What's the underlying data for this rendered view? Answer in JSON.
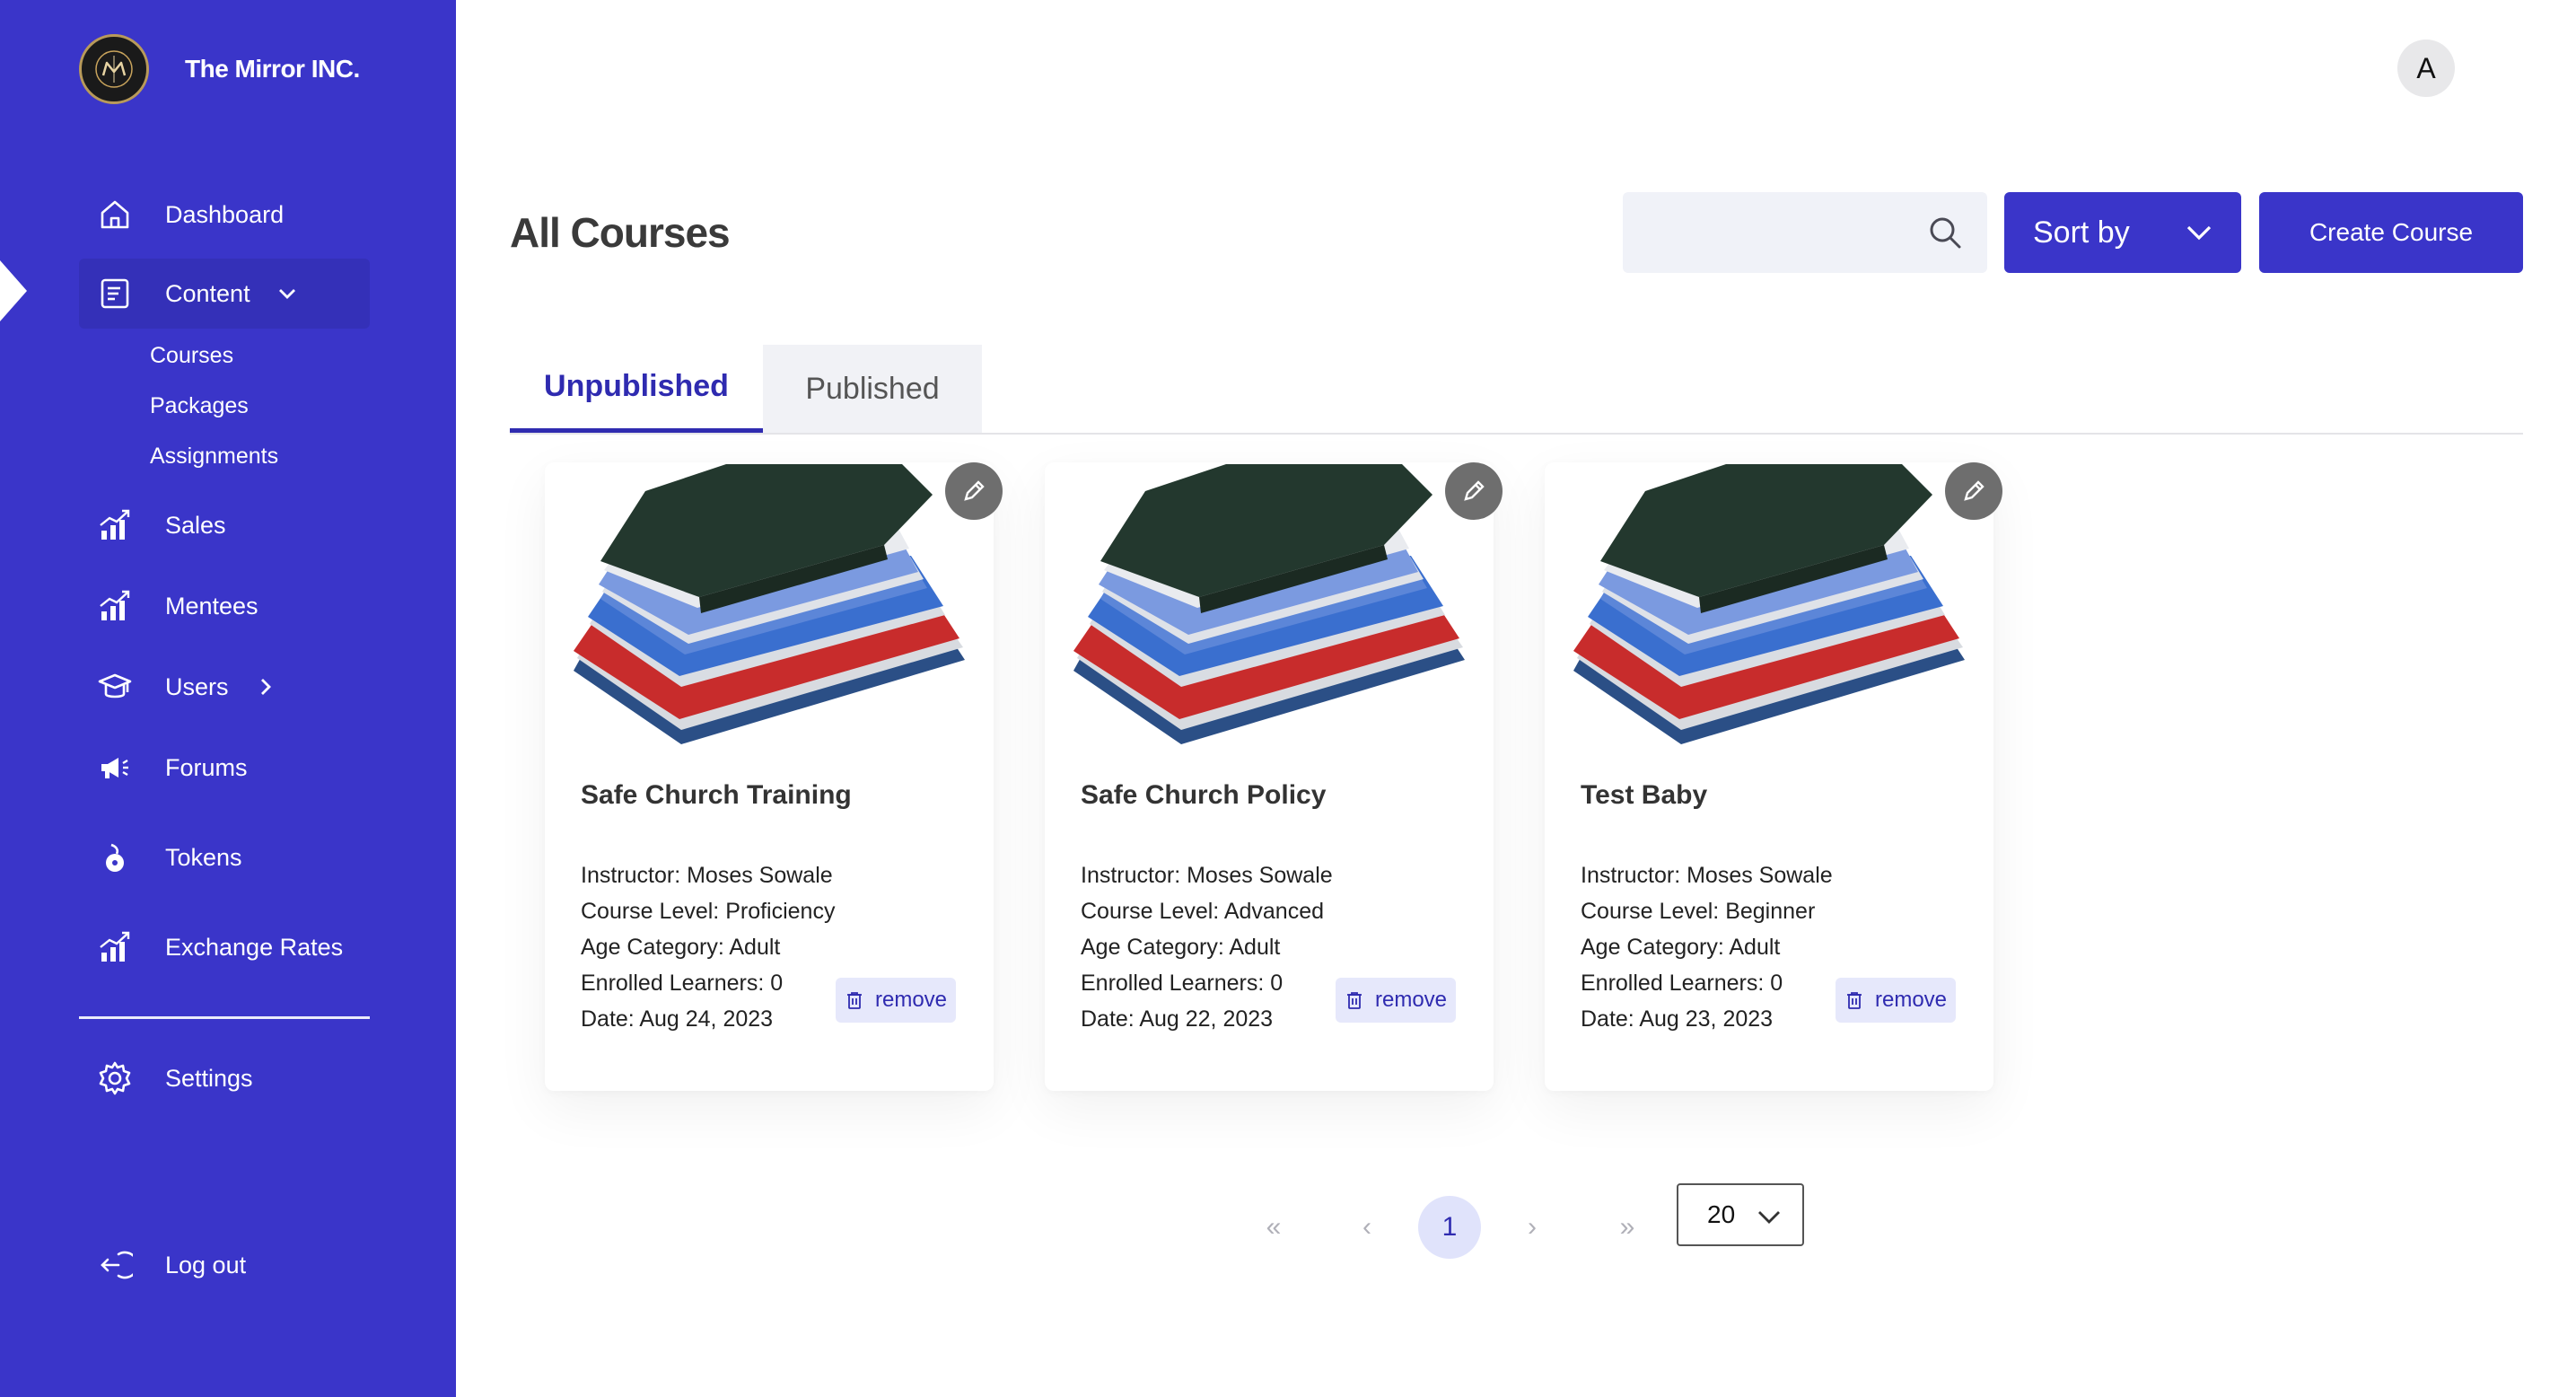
{
  "brand": {
    "name": "The Mirror INC."
  },
  "sidebar": {
    "items": [
      {
        "label": "Dashboard",
        "icon": "home-icon"
      },
      {
        "label": "Content",
        "icon": "document-icon"
      },
      {
        "label": "Sales",
        "icon": "bar-chart-icon"
      },
      {
        "label": "Mentees",
        "icon": "bar-chart-icon"
      },
      {
        "label": "Users",
        "icon": "graduation-cap-icon"
      },
      {
        "label": "Forums",
        "icon": "megaphone-icon"
      },
      {
        "label": "Tokens",
        "icon": "token-icon"
      },
      {
        "label": "Exchange Rates",
        "icon": "bar-chart-icon"
      },
      {
        "label": "Settings",
        "icon": "gear-icon"
      },
      {
        "label": "Log out",
        "icon": "logout-icon"
      }
    ],
    "content_subitems": [
      "Courses",
      "Packages",
      "Assignments"
    ]
  },
  "header": {
    "avatar_initial": "A"
  },
  "main": {
    "title": "All Courses",
    "search_placeholder": "",
    "sort_label": "Sort by",
    "create_label": "Create Course",
    "tabs": [
      {
        "label": "Unpublished",
        "active": true
      },
      {
        "label": "Published",
        "active": false
      }
    ],
    "courses": [
      {
        "title": "Safe Church Training",
        "instructor": "Instructor: Moses Sowale",
        "level": "Course Level: Proficiency",
        "age": "Age Category: Adult",
        "enrolled": "Enrolled Learners: 0",
        "date": "Date: Aug 24, 2023",
        "remove_label": "remove"
      },
      {
        "title": "Safe Church Policy",
        "instructor": "Instructor: Moses Sowale",
        "level": "Course Level: Advanced",
        "age": "Age Category: Adult",
        "enrolled": "Enrolled Learners: 0",
        "date": "Date: Aug 22, 2023",
        "remove_label": "remove"
      },
      {
        "title": "Test Baby",
        "instructor": "Instructor: Moses Sowale",
        "level": "Course Level: Beginner",
        "age": "Age Category: Adult",
        "enrolled": "Enrolled Learners: 0",
        "date": "Date: Aug 23, 2023",
        "remove_label": "remove"
      }
    ]
  },
  "pagination": {
    "first": "«",
    "prev": "‹",
    "current_page": "1",
    "next": "›",
    "last": "»",
    "per_page": "20"
  },
  "colors": {
    "sidebar_bg": "#3a35c9",
    "accent": "#2f2bb0",
    "remove_bg": "#e6e8fb"
  }
}
